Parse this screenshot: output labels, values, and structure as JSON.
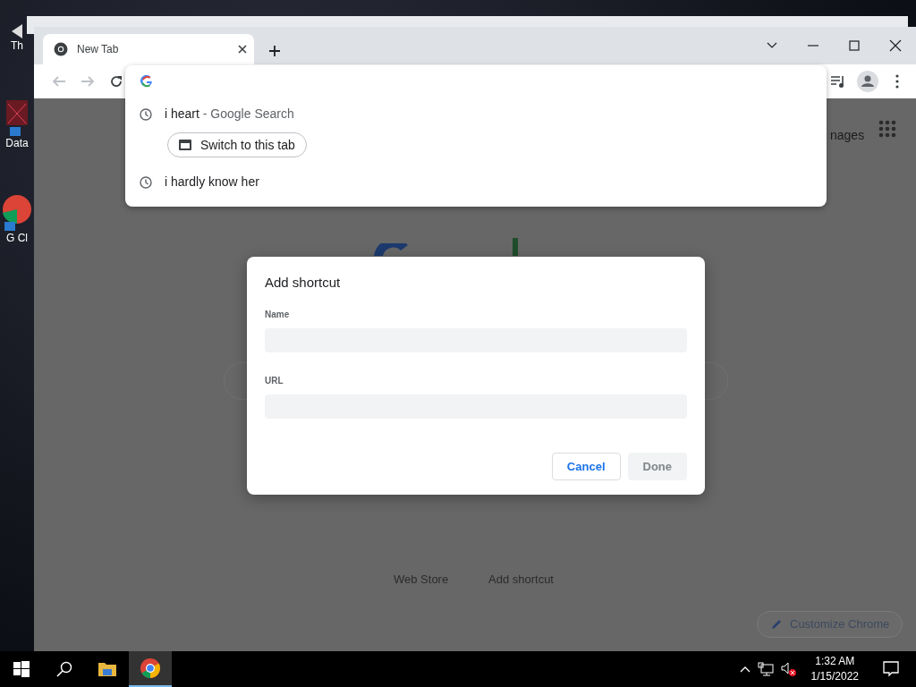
{
  "desktop": {
    "icons": [
      {
        "label": "Th"
      },
      {
        "label": "Data"
      },
      {
        "label": "G Cl"
      }
    ]
  },
  "browser": {
    "tabs": [
      {
        "title": "New Tab",
        "selected": true
      }
    ],
    "omnibox_dropdown": {
      "suggestions": [
        {
          "kind": "history",
          "text": "i heart",
          "detail": "- Google Search",
          "button": "Switch to this tab"
        },
        {
          "kind": "history",
          "text": "i hardly know her"
        }
      ]
    },
    "page": {
      "images_link": "nages",
      "shortcuts": [
        "Web Store",
        "Add shortcut"
      ],
      "customize_button": "Customize Chrome"
    },
    "dialog": {
      "title": "Add shortcut",
      "fields": [
        {
          "label": "Name"
        },
        {
          "label": "URL"
        }
      ],
      "buttons": [
        {
          "label": "Cancel",
          "kind": "secondary",
          "disabled": false
        },
        {
          "label": "Done",
          "kind": "primary",
          "disabled": true
        }
      ]
    }
  },
  "taskbar": {
    "apps": [
      {
        "kind": "folder",
        "active": false
      },
      {
        "kind": "chrome",
        "active": true
      }
    ],
    "time": "1:32 AM",
    "date": "1/15/2022"
  }
}
